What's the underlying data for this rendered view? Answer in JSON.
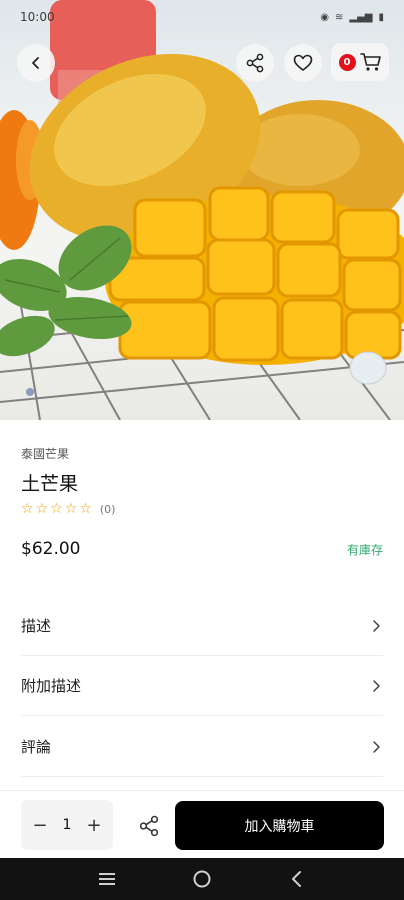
{
  "status_bar": {
    "time": "10:00",
    "icons": [
      "eye-icon",
      "wifi-icon",
      "signal-icon",
      "battery-icon"
    ]
  },
  "header": {
    "cart_count": "0"
  },
  "product": {
    "category": "泰國芒果",
    "title": "土芒果",
    "rating_stars": 0,
    "review_count": "(0)",
    "price": "$62.00",
    "stock_status": "有庫存"
  },
  "sections": [
    {
      "label": "描述"
    },
    {
      "label": "附加描述"
    },
    {
      "label": "評論"
    }
  ],
  "action_bar": {
    "quantity": "1",
    "decrement": "−",
    "increment": "+",
    "add_to_cart_label": "加入購物車"
  },
  "colors": {
    "accent": "#000000",
    "badge": "#e3101e",
    "stock": "#2fa96b",
    "star": "#e8a100"
  }
}
